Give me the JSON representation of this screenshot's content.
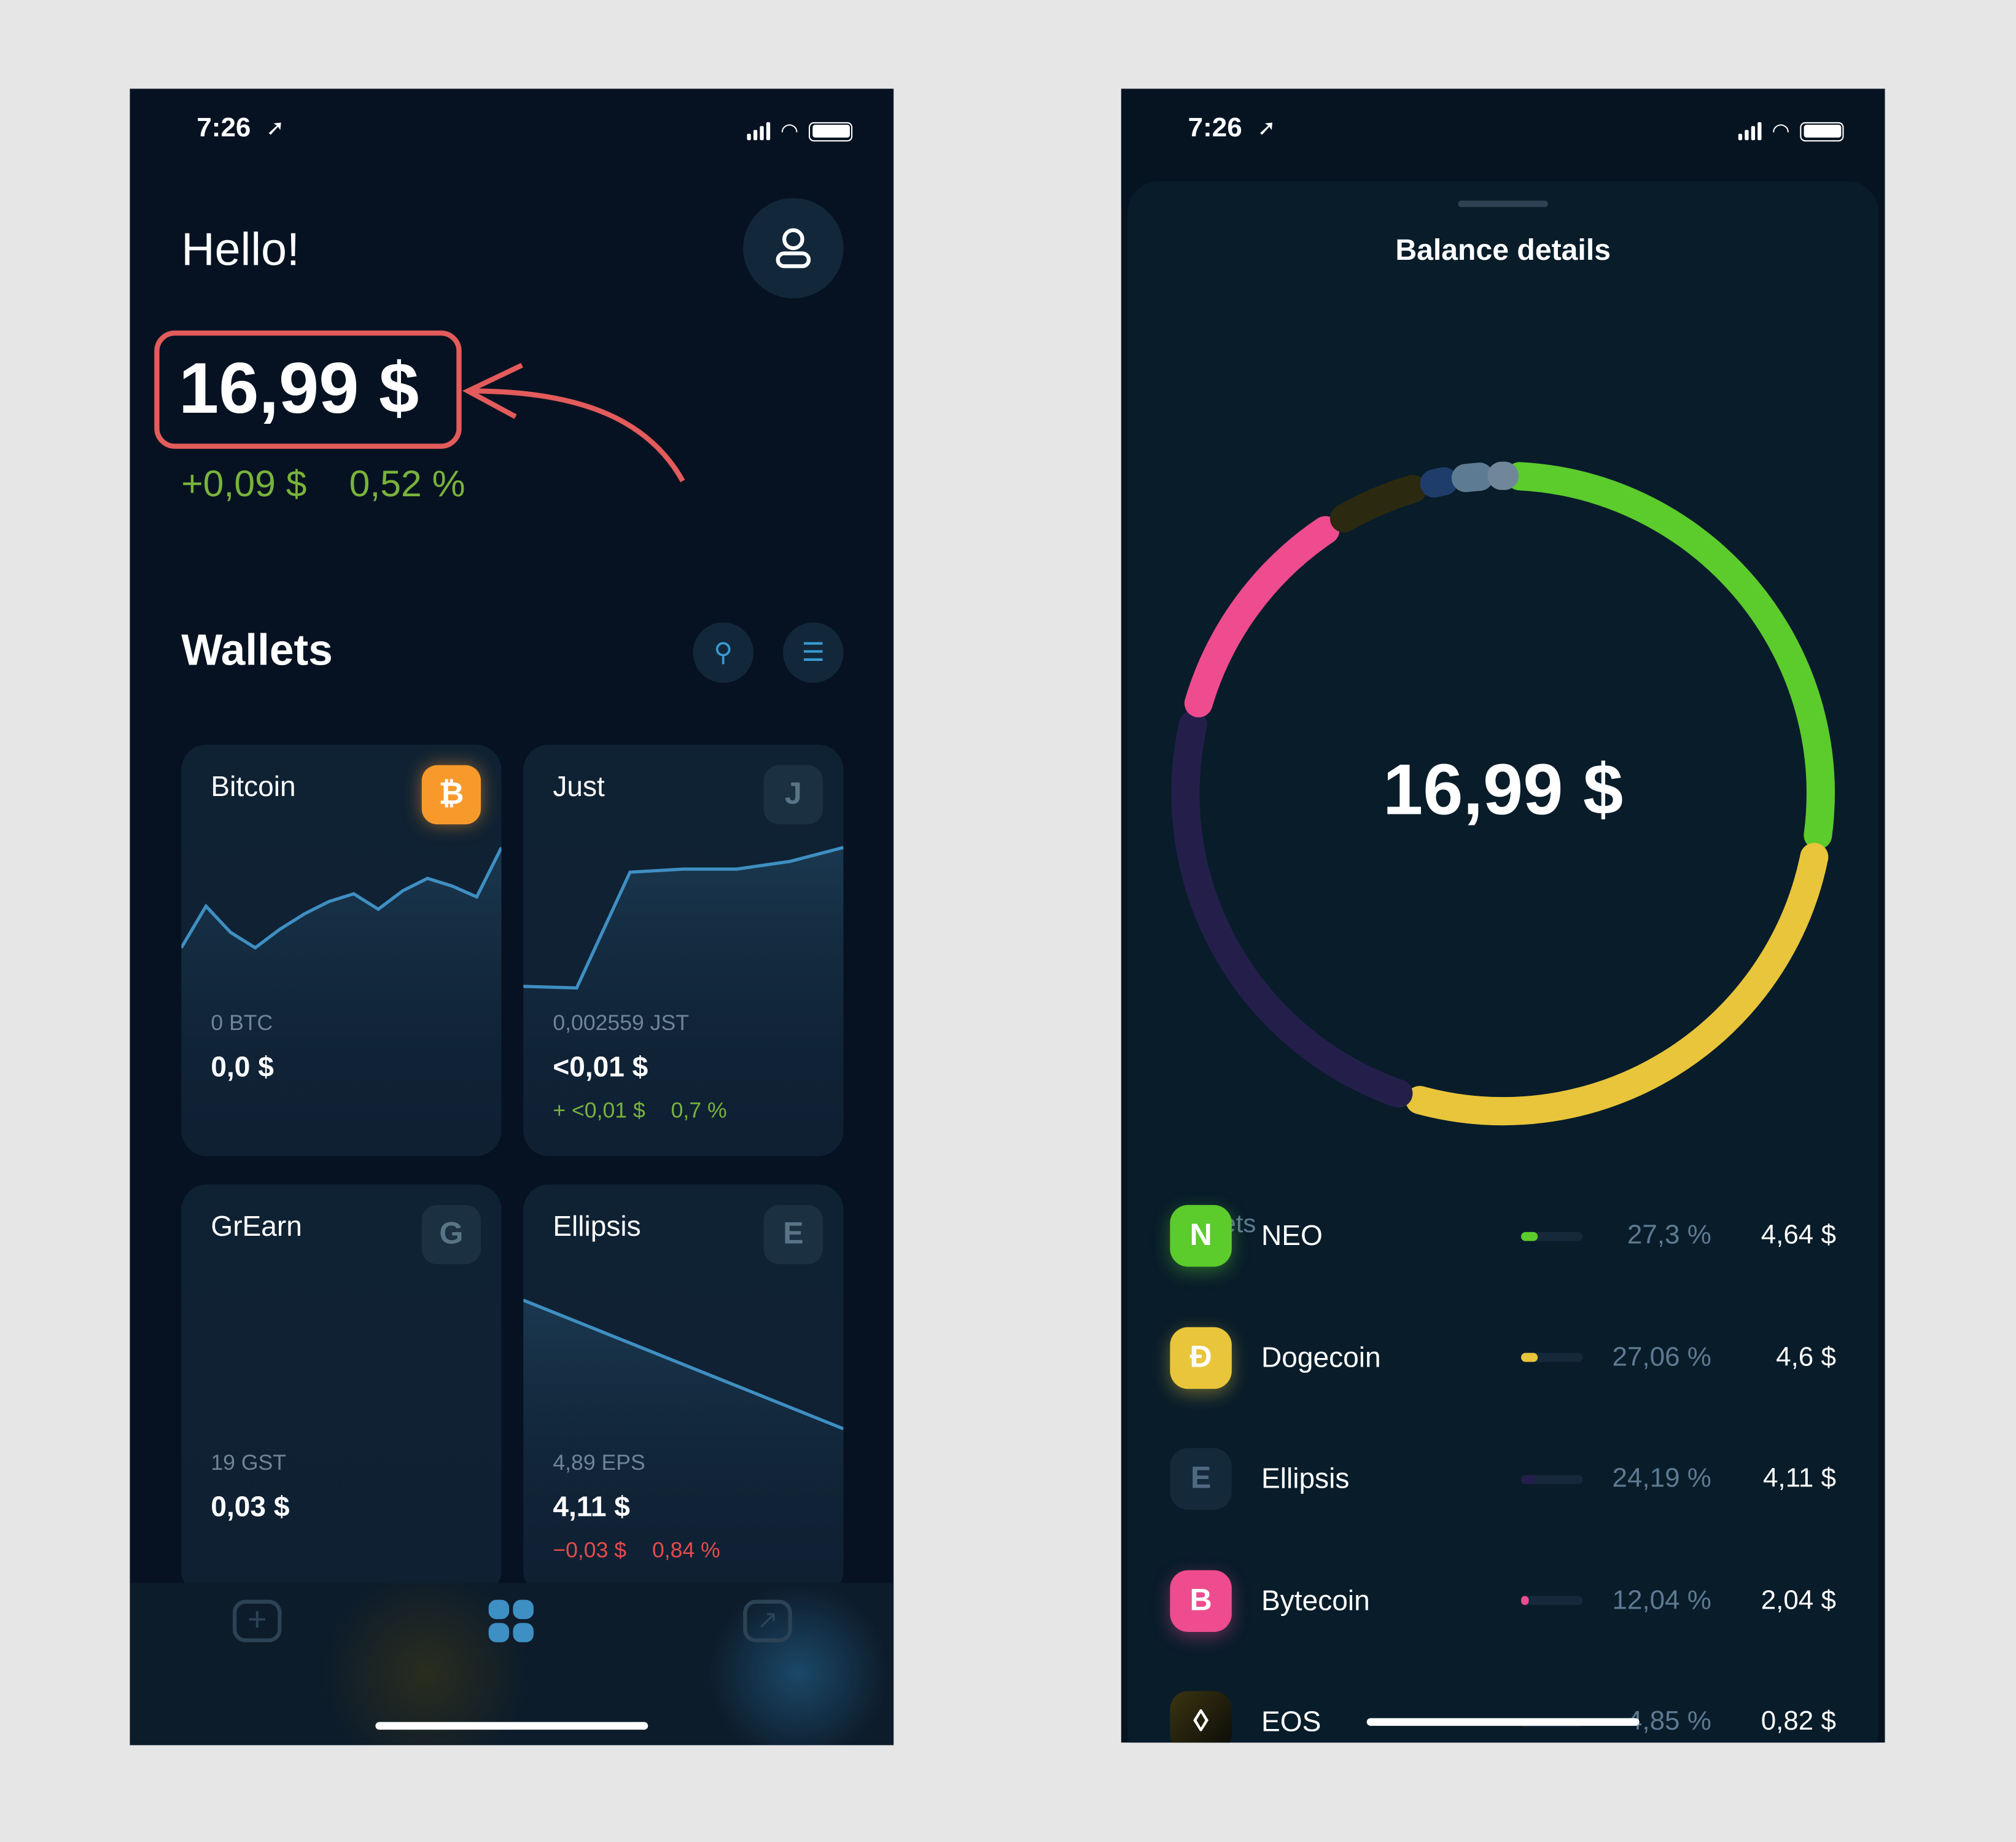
{
  "status": {
    "time": "7:26"
  },
  "home": {
    "greeting": "Hello!",
    "balance": "16,99 $",
    "change_abs": "+0,09 $",
    "change_pct": "0,52 %",
    "wallets_title": "Wallets",
    "annotation_color": "#e35b5b",
    "cards": [
      {
        "name": "Bitcoin",
        "badge": "₿",
        "amount": "0 BTC",
        "usd": "0,0 $",
        "chart": [
          0.35,
          0.62,
          0.45,
          0.35,
          0.47,
          0.57,
          0.65,
          0.7,
          0.6,
          0.72,
          0.8,
          0.75,
          0.68,
          1.0
        ],
        "icon_color": "#f79a2b"
      },
      {
        "name": "Just",
        "badge": "J",
        "amount": "0,002559 JST",
        "usd": "<0,01 $",
        "change_abs": "+ <0,01 $",
        "change_pct": "0,7 %",
        "change_color": "#79b33c",
        "chart": [
          0.1,
          0.09,
          0.84,
          0.86,
          0.86,
          0.91,
          1.0
        ]
      },
      {
        "name": "GrEarn",
        "badge": "G",
        "amount": "19 GST",
        "usd": "0,03 $"
      },
      {
        "name": "Ellipsis",
        "badge": "E",
        "amount": "4,89 EPS",
        "usd": "4,11 $",
        "change_abs": "−0,03 $",
        "change_pct": "0,84 %",
        "change_color": "#e44c4c",
        "chart": [
          1.0,
          0.0
        ]
      }
    ],
    "tabbar": [
      {
        "icon": "plus-square-icon"
      },
      {
        "icon": "grid-icon",
        "active": true
      },
      {
        "icon": "arrow-up-right-square-icon"
      }
    ]
  },
  "details": {
    "title": "Balance details",
    "total": "16,99 $",
    "wallets_label": "Wallets",
    "rows": [
      {
        "name": "NEO",
        "pct": "27,3 %",
        "value": "4,64 $",
        "share": 27.3,
        "color": "#5ccb2c",
        "icon": "neo-icon",
        "glyph": "N"
      },
      {
        "name": "Dogecoin",
        "pct": "27,06 %",
        "value": "4,6 $",
        "share": 27.06,
        "color": "#e8c53a",
        "icon": "dogecoin-icon",
        "glyph": "Đ"
      },
      {
        "name": "Ellipsis",
        "pct": "24,19 %",
        "value": "4,11 $",
        "share": 24.19,
        "color": "#241f4a",
        "icon": "ellipsis-icon",
        "glyph": "E"
      },
      {
        "name": "Bytecoin",
        "pct": "12,04 %",
        "value": "2,04 $",
        "share": 12.04,
        "color": "#ee4c8e",
        "icon": "bytecoin-icon",
        "glyph": "B"
      },
      {
        "name": "EOS",
        "pct": "4,85 %",
        "value": "0,82 $",
        "share": 4.85,
        "color": "#2b2a10",
        "icon": "eos-icon",
        "glyph": "◊"
      }
    ],
    "extra_segments": [
      {
        "share": 1.6,
        "color": "#1f3d6b"
      },
      {
        "share": 1.8,
        "color": "#5d7b93"
      },
      {
        "share": 0.9,
        "color": "#6f8799"
      }
    ]
  }
}
